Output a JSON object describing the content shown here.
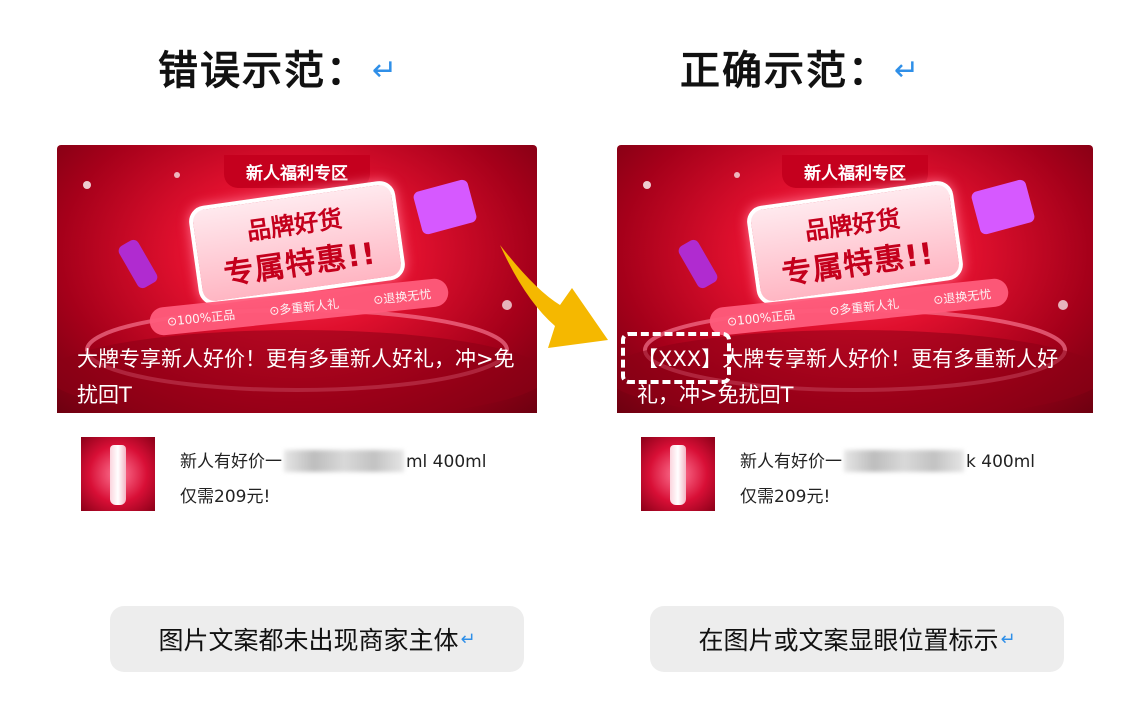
{
  "left_panel": {
    "heading": "错误示范：",
    "return_mark": "↵",
    "banner": {
      "zone_label": "新人福利专区",
      "tag_line1": "品牌好货",
      "tag_line2": "专属特惠!!",
      "ribbon_items": [
        "⊙100%正品",
        "⊙多重新人礼",
        "⊙退换无忧"
      ],
      "text": "大牌专享新人好价！更有多重新人好礼，冲>免扰回T"
    },
    "product": {
      "line1_start": "新人有好价一",
      "line1_end": "ml 400ml",
      "line2": "仅需209元!"
    },
    "caption": "图片文案都未出现商家主体"
  },
  "right_panel": {
    "heading": "正确示范：",
    "return_mark": "↵",
    "banner": {
      "zone_label": "新人福利专区",
      "tag_line1": "品牌好货",
      "tag_line2": "专属特惠!!",
      "ribbon_items": [
        "⊙100%正品",
        "⊙多重新人礼",
        "⊙退换无忧"
      ],
      "text": "【XXX】大牌专享新人好价！更有多重新人好礼，冲>免扰回T"
    },
    "product": {
      "line1_start": "新人有好价一",
      "line1_end": "k 400ml",
      "line2": "仅需209元!"
    },
    "caption": "在图片或文案显眼位置标示"
  },
  "colors": {
    "banner_red": "#e0102e",
    "arrow_yellow": "#f5b800",
    "return_blue": "#2f8fe8",
    "caption_bg": "#ededed"
  }
}
